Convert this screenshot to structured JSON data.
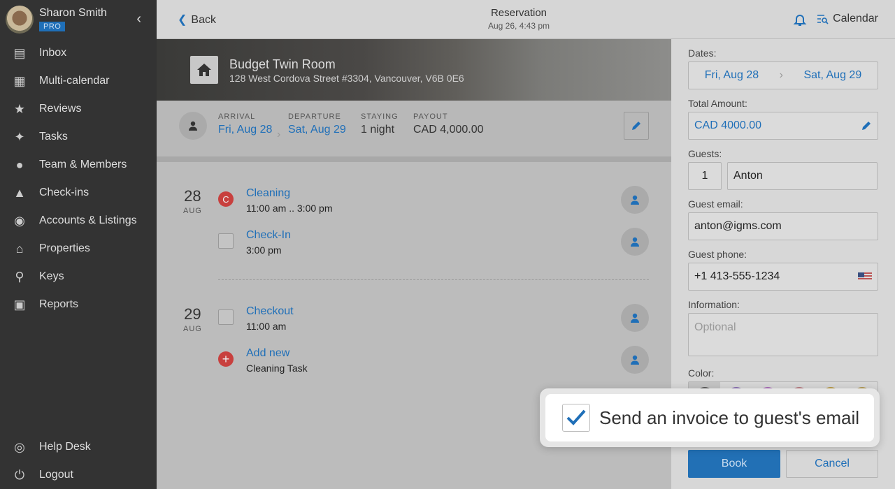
{
  "sidebar": {
    "user_name": "Sharon Smith",
    "badge": "PRO",
    "items": [
      {
        "label": "Inbox",
        "icon": "inbox-icon"
      },
      {
        "label": "Multi-calendar",
        "icon": "calendar-icon"
      },
      {
        "label": "Reviews",
        "icon": "star-icon"
      },
      {
        "label": "Tasks",
        "icon": "broom-icon"
      },
      {
        "label": "Team & Members",
        "icon": "team-icon"
      },
      {
        "label": "Check-ins",
        "icon": "bell-desk-icon"
      },
      {
        "label": "Accounts & Listings",
        "icon": "account-icon"
      },
      {
        "label": "Properties",
        "icon": "home-icon"
      },
      {
        "label": "Keys",
        "icon": "key-icon"
      },
      {
        "label": "Reports",
        "icon": "chart-icon"
      }
    ],
    "bottom": [
      {
        "label": "Help Desk",
        "icon": "lifebuoy-icon"
      },
      {
        "label": "Logout",
        "icon": "power-icon"
      }
    ]
  },
  "header": {
    "back": "Back",
    "title": "Reservation",
    "subtitle": "Aug 26, 4:43 pm",
    "calendar": "Calendar"
  },
  "property": {
    "name": "Budget Twin Room",
    "address": "128 West Cordova Street #3304, Vancouver, V6B 0E6"
  },
  "summary": {
    "arrival_label": "ARRIVAL",
    "arrival": "Fri, Aug 28",
    "departure_label": "DEPARTURE",
    "departure": "Sat, Aug 29",
    "staying_label": "STAYING",
    "staying": "1 night",
    "payout_label": "PAYOUT",
    "payout": "CAD 4,000.00"
  },
  "days": [
    {
      "num": "28",
      "month": "AUG"
    },
    {
      "num": "29",
      "month": "AUG"
    }
  ],
  "tasks": [
    {
      "title": "Cleaning",
      "sub": "11:00 am .. 3:00 pm",
      "marker": "C"
    },
    {
      "title": "Check-In",
      "sub": "3:00 pm"
    },
    {
      "title": "Checkout",
      "sub": "11:00 am"
    },
    {
      "title": "Add new",
      "sub": "Cleaning Task"
    }
  ],
  "form": {
    "dates_label": "Dates:",
    "date_from": "Fri, Aug 28",
    "date_to": "Sat, Aug 29",
    "total_label": "Total Amount:",
    "total": "CAD 4000.00",
    "guests_label": "Guests:",
    "guest_count": "1",
    "guest_name": "Anton",
    "email_label": "Guest email:",
    "email": "anton@igms.com",
    "phone_label": "Guest phone:",
    "phone": "+1 413-555-1234",
    "info_label": "Information:",
    "info_placeholder": "Optional",
    "color_label": "Color:",
    "colors": [
      "#5a5a5a",
      "#8a6fb3",
      "#a96bb8",
      "#b87b80",
      "#b99a45",
      "#b39b55"
    ],
    "book": "Book",
    "cancel": "Cancel"
  },
  "callout": {
    "label": "Send an invoice to guest's email",
    "checked": true
  },
  "accent": "#1f6fb8"
}
